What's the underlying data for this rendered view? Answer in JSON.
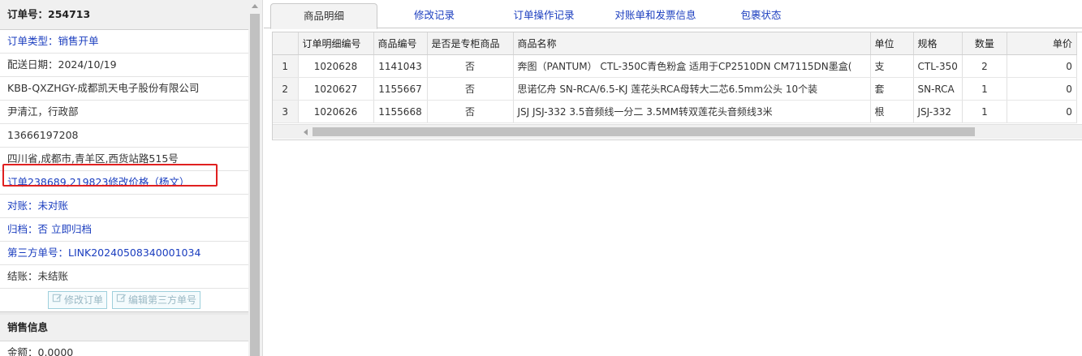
{
  "order": {
    "title": "订单号：254713",
    "rows": [
      {
        "label": "订单类型：",
        "value": "销售开单"
      },
      {
        "text": "配送日期：2024/10/19"
      },
      {
        "text": "KBB-QXZHGY-成都凯天电子股份有限公司"
      },
      {
        "text": "尹清江，行政部"
      },
      {
        "text": "13666197208"
      },
      {
        "text": "四川省,成都市,青羊区,西货站路515号"
      },
      {
        "text": "订单238689,219823修改价格（杨文）"
      },
      {
        "label": "对账：",
        "value": "未对账"
      },
      {
        "label": "归档：",
        "value": "否 立即归档"
      },
      {
        "label": "第三方单号：",
        "value": "LINK20240508340001034"
      },
      {
        "text": "结账：未结账"
      }
    ],
    "buttons": {
      "edit_order": "修改订单",
      "edit_third": "编辑第三方单号"
    }
  },
  "sales": {
    "title": "销售信息",
    "amount": "金额：0.0000"
  },
  "tabs": [
    "商品明细",
    "修改记录",
    "订单操作记录",
    "对账单和发票信息",
    "包裹状态"
  ],
  "grid": {
    "headers": [
      "订单明细编号",
      "商品编号",
      "是否是专柜商品",
      "商品名称",
      "单位",
      "规格",
      "数量",
      "单价"
    ],
    "rows": [
      {
        "num": "1",
        "detail_id": "1020628",
        "product_id": "1141043",
        "counter": "否",
        "name": "奔图（PANTUM） CTL-350C青色粉盒 适用于CP2510DN CM7115DN墨盒(",
        "unit": "支",
        "spec": "CTL-350",
        "qty": "2",
        "price": "0"
      },
      {
        "num": "2",
        "detail_id": "1020627",
        "product_id": "1155667",
        "counter": "否",
        "name": "思诺亿舟 SN-RCA/6.5-KJ 莲花头RCA母转大二芯6.5mm公头 10个装",
        "unit": "套",
        "spec": "SN-RCA",
        "qty": "1",
        "price": "0"
      },
      {
        "num": "3",
        "detail_id": "1020626",
        "product_id": "1155668",
        "counter": "否",
        "name": "JSJ JSJ-332 3.5音频线一分二 3.5MM转双莲花头音频线3米",
        "unit": "根",
        "spec": "JSJ-332",
        "qty": "1",
        "price": "0"
      }
    ]
  },
  "colors": {
    "link": "#1a3dbf",
    "highlight": "#e02020"
  }
}
